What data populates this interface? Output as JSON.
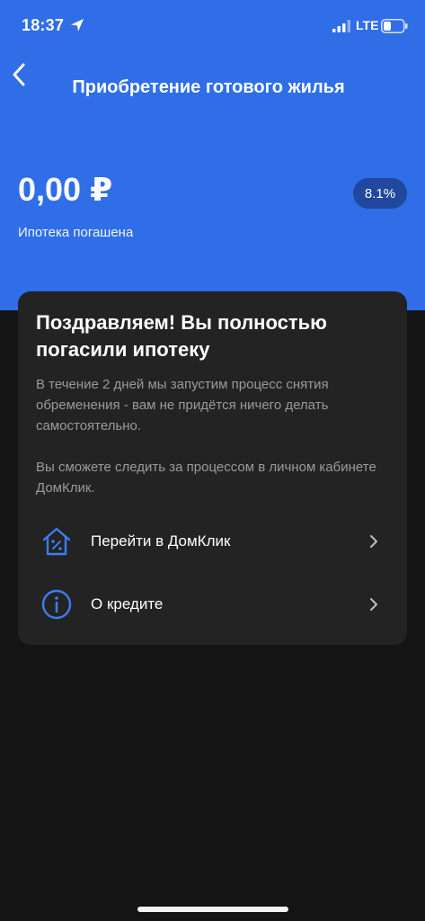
{
  "status_bar": {
    "time": "18:37",
    "network": "LTE",
    "icons": [
      "location-arrow-icon",
      "signal-bars-icon",
      "battery-icon"
    ]
  },
  "header": {
    "title": "Приобретение готового жилья",
    "back_icon": "chevron-left-icon",
    "accent_color": "#2f6ee6"
  },
  "loan": {
    "amount": "0,00 ₽",
    "rate": "8.1%",
    "status": "Ипотека погашена"
  },
  "card": {
    "title": "Поздравляем! Вы полностью погасили ипотеку",
    "text1": "В течение 2 дней мы запустим процесс снятия обременения - вам не придётся ничего делать самостоятельно.",
    "text2": "Вы сможете следить за процессом в личном кабинете ДомКлик.",
    "actions": [
      {
        "label": "Перейти в ДомКлик",
        "icon": "house-percent-icon"
      },
      {
        "label": "О кредите",
        "icon": "info-icon"
      }
    ]
  }
}
